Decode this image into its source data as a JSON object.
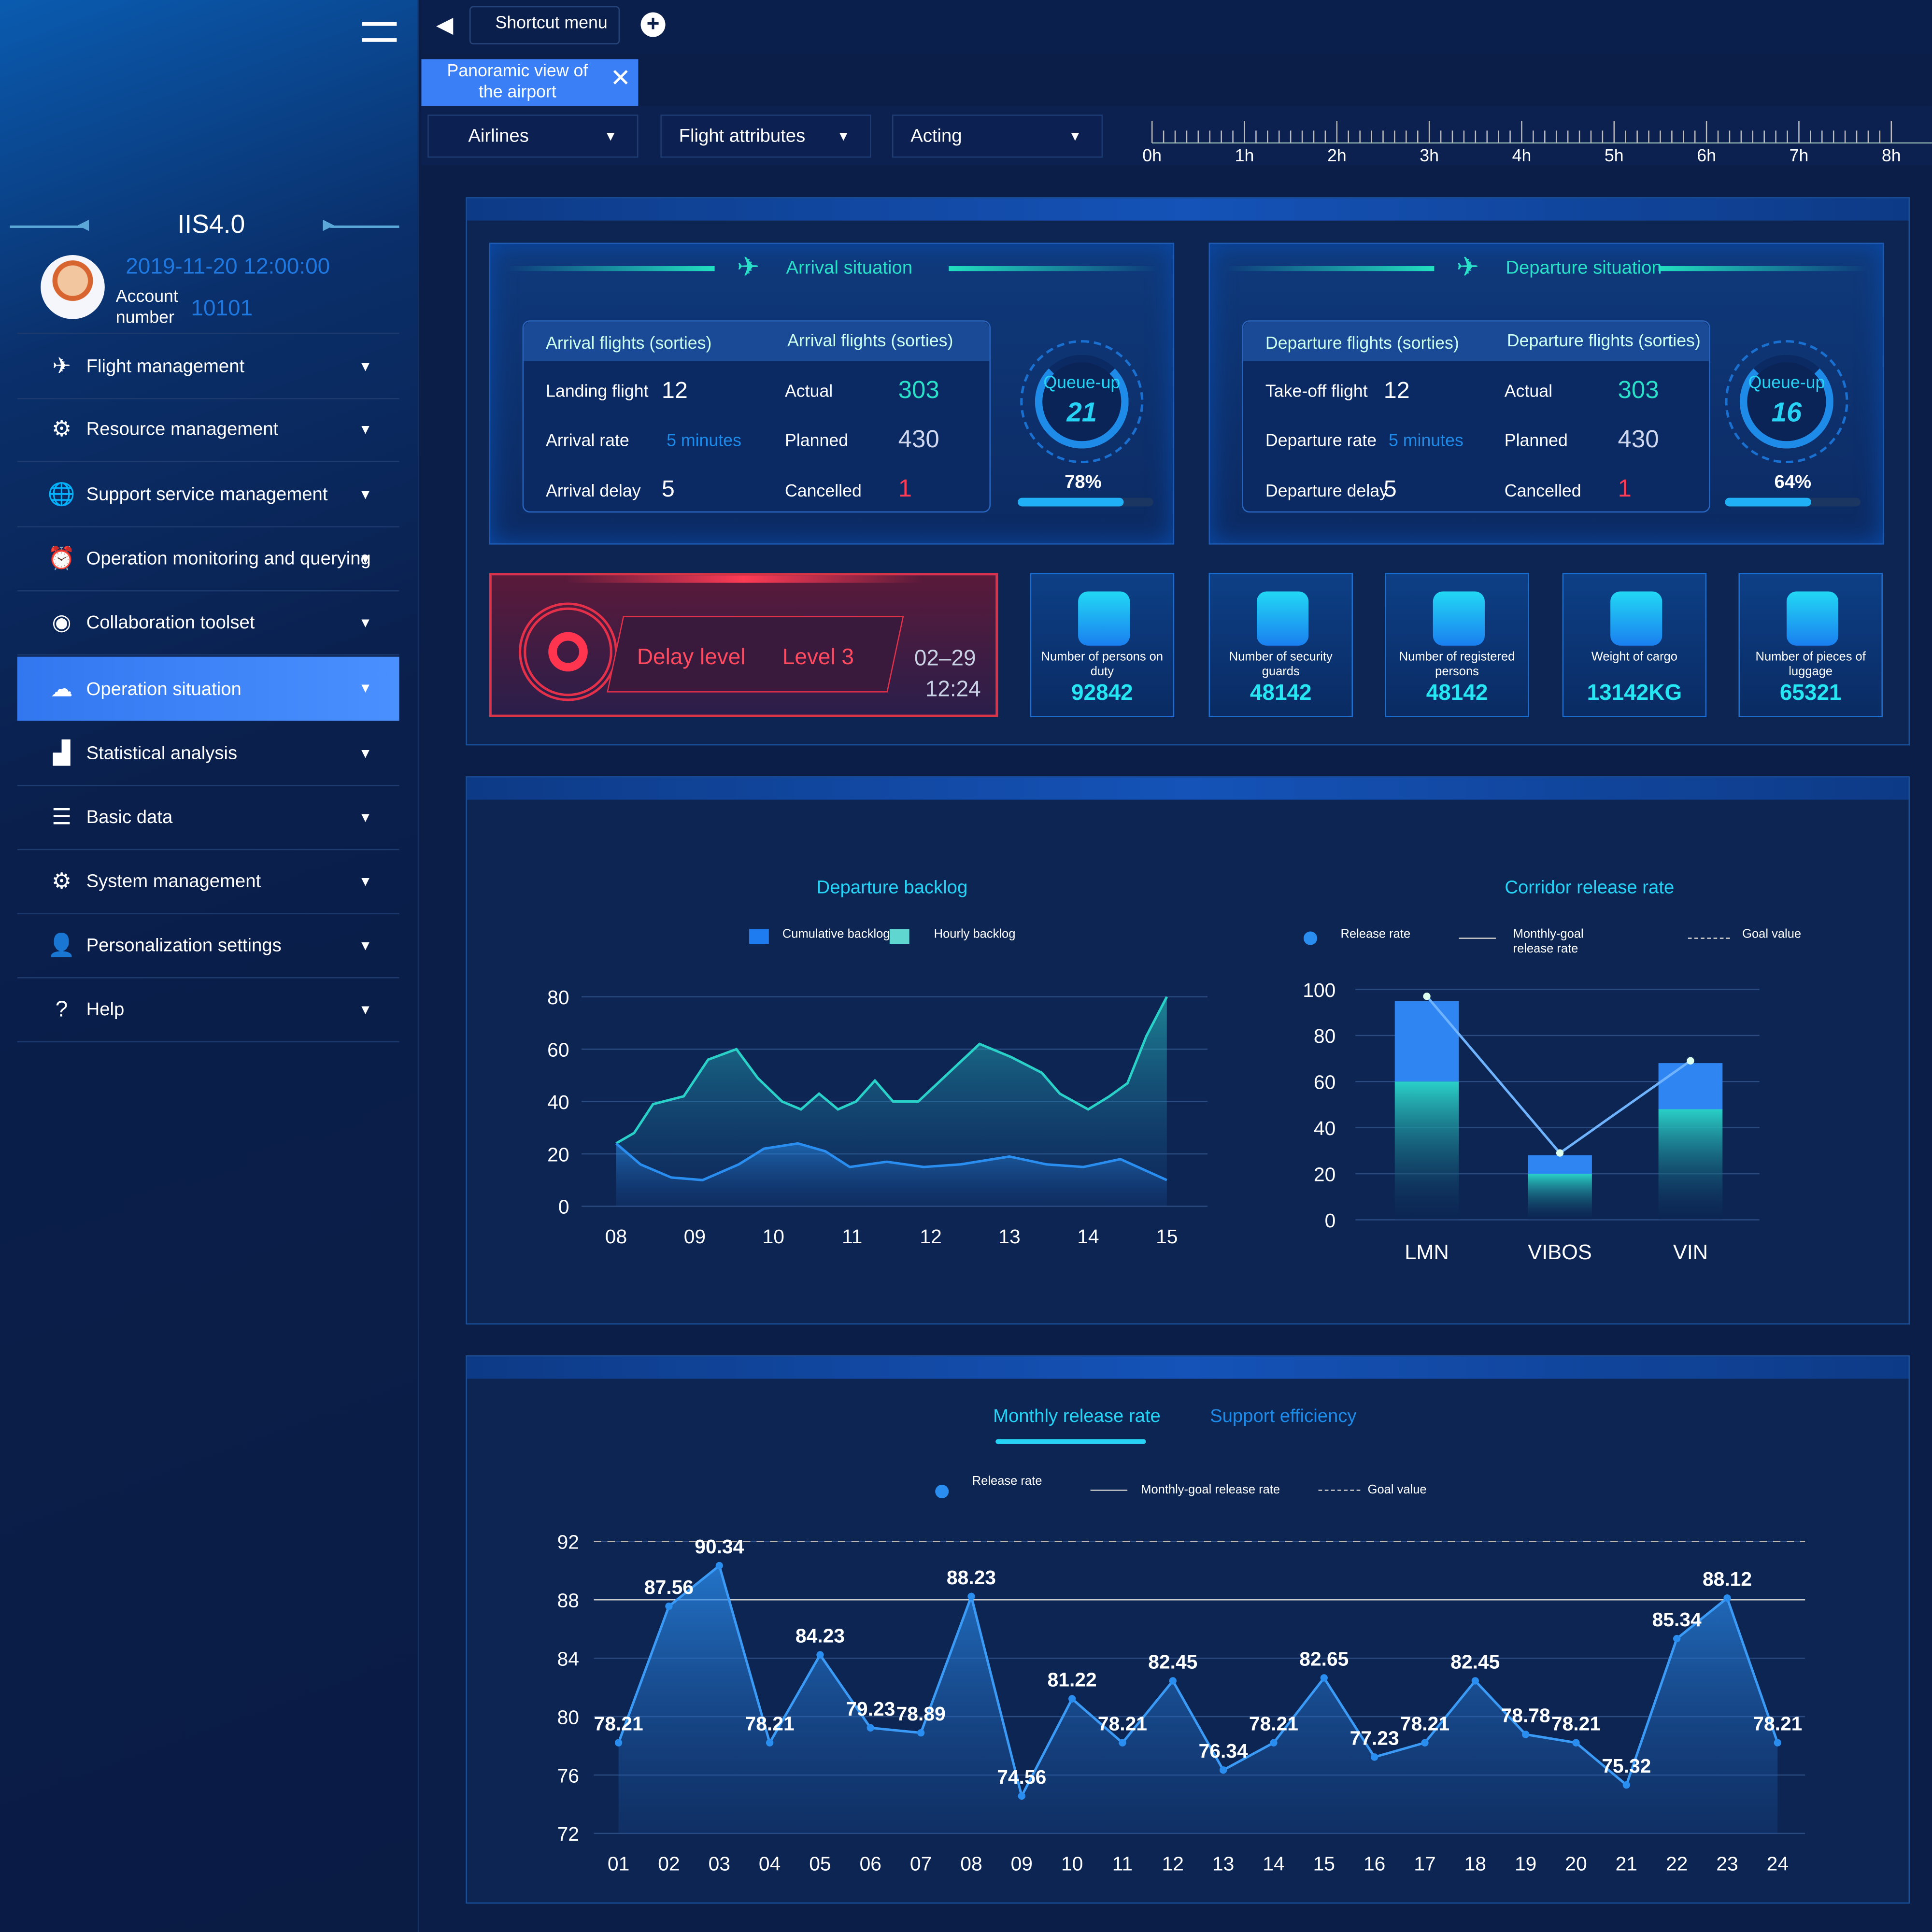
{
  "sidebar": {
    "system": "IIS4.0",
    "datetime": "2019-11-20 12:00:00",
    "account_label": "Account number",
    "account": "10101",
    "items": [
      {
        "label": "Flight management",
        "icon": "airplane-icon"
      },
      {
        "label": "Resource management",
        "icon": "gear-dashed-icon"
      },
      {
        "label": "Support service management",
        "icon": "globe-icon"
      },
      {
        "label": "Operation monitoring and querying",
        "icon": "alarm-icon"
      },
      {
        "label": "Collaboration toolset",
        "icon": "collaboration-icon"
      },
      {
        "label": "Operation situation",
        "icon": "cloud-icon",
        "active": true
      },
      {
        "label": "Statistical analysis",
        "icon": "bar-chart-icon"
      },
      {
        "label": "Basic data",
        "icon": "database-icon"
      },
      {
        "label": "System management",
        "icon": "gear-icon"
      },
      {
        "label": "Personalization settings",
        "icon": "user-settings-icon"
      },
      {
        "label": "Help",
        "icon": "help-icon"
      }
    ]
  },
  "topbar": {
    "shortcut": "Shortcut menu",
    "tab": "Panoramic view of the airport"
  },
  "filters": {
    "airlines": "Airlines",
    "attributes": "Flight attributes",
    "acting": "Acting"
  },
  "timeline": [
    "0h",
    "1h",
    "2h",
    "3h",
    "4h",
    "5h",
    "6h",
    "7h",
    "8h"
  ],
  "arrival": {
    "title": "Arrival situation",
    "col1": "Arrival flights (sorties)",
    "col2": "Arrival flights (sorties)",
    "r1l": "Landing flight",
    "r1v": "12",
    "r2l": "Arrival rate",
    "r2v": "5 minutes",
    "r3l": "Arrival delay",
    "r3v": "5",
    "a": "Actual",
    "av": "303",
    "p": "Planned",
    "pv": "430",
    "c": "Cancelled",
    "cv": "1",
    "queue": "Queue-up",
    "queue_v": "21",
    "pct": "78%",
    "progress": 0.78
  },
  "departure": {
    "title": "Departure situation",
    "col1": "Departure flights (sorties)",
    "col2": "Departure flights (sorties)",
    "r1l": "Take-off flight",
    "r1v": "12",
    "r2l": "Departure rate",
    "r2v": "5 minutes",
    "r3l": "Departure delay",
    "r3v": "5",
    "a": "Actual",
    "av": "303",
    "p": "Planned",
    "pv": "430",
    "c": "Cancelled",
    "cv": "1",
    "queue": "Queue-up",
    "queue_v": "16",
    "pct": "64%",
    "progress": 0.64
  },
  "delay": {
    "label": "Delay level",
    "level": "Level 3",
    "date": "02–29",
    "time": "12:24"
  },
  "stats": [
    {
      "label": "Number of persons on duty",
      "value": "92842",
      "icon": "staff-icon"
    },
    {
      "label": "Number of security guards",
      "value": "48142",
      "icon": "security-icon"
    },
    {
      "label": "Number of registered persons",
      "value": "48142",
      "icon": "checkin-icon"
    },
    {
      "label": "Weight of cargo",
      "value": "13142KG",
      "icon": "cargo-icon"
    },
    {
      "label": "Number of pieces of luggage",
      "value": "65321",
      "icon": "luggage-icon"
    }
  ],
  "chart_data": [
    {
      "type": "area",
      "title": "Departure backlog",
      "xlim": [
        8,
        15
      ],
      "ylim": [
        0,
        80
      ],
      "xticks": [
        "08",
        "09",
        "10",
        "11",
        "12",
        "13",
        "14",
        "15"
      ],
      "yticks": [
        0,
        20,
        40,
        60,
        80
      ],
      "grid": true,
      "legend": "top",
      "series": [
        {
          "name": "Cumulative backlog",
          "color": "#2ad1c8",
          "x": [
            8,
            8.23,
            8.47,
            8.86,
            9.17,
            9.53,
            9.8,
            10.11,
            10.35,
            10.58,
            10.82,
            11.05,
            11.29,
            11.52,
            11.84,
            12.23,
            12.62,
            13.02,
            13.41,
            13.64,
            14.0,
            14.27,
            14.5,
            14.74,
            15.0
          ],
          "y": [
            24,
            28,
            39,
            42,
            56,
            60,
            49,
            40,
            37,
            43,
            37,
            40,
            48,
            40,
            40,
            51,
            62,
            57,
            51,
            43,
            37,
            42,
            47,
            65,
            80
          ]
        },
        {
          "name": "Hourly backlog",
          "color": "#2a8ef0",
          "x": [
            8,
            8.31,
            8.7,
            9.1,
            9.56,
            9.88,
            10.31,
            10.66,
            10.97,
            11.44,
            11.91,
            12.38,
            13.0,
            13.47,
            13.94,
            14.41,
            15.0
          ],
          "y": [
            24,
            16,
            11,
            10,
            16,
            22,
            24,
            21,
            15,
            17,
            15,
            16,
            19,
            16,
            15,
            18,
            10
          ]
        }
      ]
    },
    {
      "type": "bar",
      "title": "Corridor release rate",
      "categories": [
        "LMN",
        "VIBOS",
        "VIN"
      ],
      "ylim": [
        0,
        100
      ],
      "yticks": [
        0,
        20,
        40,
        60,
        80,
        100
      ],
      "legend": [
        "Release rate",
        "Monthly-goal release rate",
        "Goal value"
      ],
      "bars_total": [
        95,
        28,
        68
      ],
      "bars_lower": [
        60,
        20,
        48
      ],
      "release_rate": [
        97,
        29,
        69
      ]
    },
    {
      "type": "area",
      "title": "Monthly release rate",
      "tabs": [
        "Monthly release rate",
        "Support efficiency"
      ],
      "legend": [
        "Release rate",
        "Monthly-goal release rate",
        "Goal value"
      ],
      "categories": [
        "01",
        "02",
        "03",
        "04",
        "05",
        "06",
        "07",
        "08",
        "09",
        "10",
        "11",
        "12",
        "13",
        "14",
        "15",
        "16",
        "17",
        "18",
        "19",
        "20",
        "21",
        "22",
        "23",
        "24"
      ],
      "values": [
        78.21,
        87.56,
        90.34,
        78.21,
        84.23,
        79.23,
        78.89,
        88.23,
        74.56,
        81.22,
        78.21,
        82.45,
        76.34,
        78.21,
        82.65,
        77.23,
        78.21,
        82.45,
        78.78,
        78.21,
        75.32,
        85.34,
        88.12,
        78.21
      ],
      "ylim": [
        72,
        92
      ],
      "yticks": [
        72,
        76,
        80,
        84,
        88,
        92
      ],
      "goal_value": 92,
      "monthly_goal": 88
    }
  ]
}
